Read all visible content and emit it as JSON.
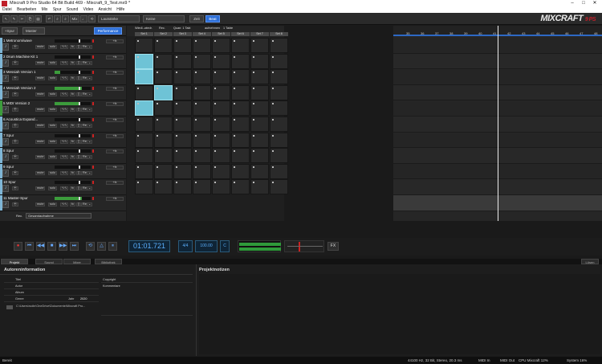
{
  "window": {
    "title": "Mixcraft 9 Pro Studio 64 Bit Build 469 - Mixcraft_9_Test.mx9 *"
  },
  "menu": [
    "Datei",
    "Bearbeiten",
    "Mix",
    "Spur",
    "Sound",
    "Video",
    "Ansicht",
    "Hilfe"
  ],
  "toolbar": {
    "mix_label": "Mix",
    "loudness_select": "Lautstärke",
    "keep_select": "Keine",
    "zeit_label": "Zeit",
    "beat_label": "Beat",
    "brand": "MIXCRAFT",
    "brand_suffix": "9 PS"
  },
  "trackpanel": {
    "add_track": "+Spur",
    "mode_select": "Master",
    "performance_button": "Performance"
  },
  "tracks": [
    {
      "name": "1 Metronom/wave",
      "color": "#7fb6d6",
      "meter": 0
    },
    {
      "name": "2 Drum Machine Kit 1",
      "color": "#7fb6d6",
      "meter": 0
    },
    {
      "name": "3 Messiah Version 1",
      "color": "#7fb6d6",
      "meter": 0.15
    },
    {
      "name": "4 Messiah Version 2",
      "color": "#7fb6d6",
      "meter": 0.75
    },
    {
      "name": "5 MIDI Version 2",
      "color": "#3c9c3c",
      "meter": 0.7
    },
    {
      "name": "6 Acoustica Expand...",
      "color": "#7fb6d6",
      "meter": 0
    },
    {
      "name": "7 Spur",
      "color": "#7fb6d6",
      "meter": 0
    },
    {
      "name": "8 Spur",
      "color": "#7fb6d6",
      "meter": 0
    },
    {
      "name": "9 Spur",
      "color": "#7fb6d6",
      "meter": 0
    },
    {
      "name": "10 Spur",
      "color": "#7fb6d6",
      "meter": 0
    },
    {
      "name": "11 Master-Spur",
      "color": "#7fb6d6",
      "meter": 0.75
    }
  ],
  "track_controls": {
    "mute": "mute",
    "solo": "solo",
    "fx": "fx",
    "rec": "Rec.",
    "fx_short": "+fx"
  },
  "master_extra": {
    "rec_label": "Rec.",
    "rec_select": "Gesamtaufnahme"
  },
  "grid": {
    "header_items": [
      "Wiedl.-wiedr.",
      "Rec.",
      "Quan: 1 Takt",
      "aufnehmen",
      "1 Takte"
    ],
    "sets": [
      "Set 1",
      "Set 2",
      "Set 3",
      "Set 4",
      "Set 5",
      "Set 6",
      "Set 7",
      "Set 8"
    ]
  },
  "ruler": [
    "35",
    "36",
    "37",
    "38",
    "39",
    "40",
    "41",
    "42",
    "43",
    "44",
    "45",
    "46",
    "47",
    "48"
  ],
  "transport": {
    "time": "01:01.721",
    "signature": "4/4",
    "tempo": "100.00",
    "key": "C",
    "fx_label": "FX"
  },
  "bottom_tabs": [
    "Projekt",
    "Sound",
    "Mixer",
    "Bibliothek"
  ],
  "bottom_tab_right": "Lösen",
  "author_info": {
    "heading": "Autoreninformation",
    "fields": [
      "Titel",
      "Autor",
      "Album",
      "Genre"
    ],
    "year_label": "Jahr",
    "year_value": "2020",
    "copyright_label": "Copyright",
    "comments_label": "Kommentare",
    "path": "C:\\Users\\rudin\\OneDrive\\Dokumente\\Mixcraft Pro..."
  },
  "project_notes": {
    "heading": "Projektnotizen"
  },
  "statusbar": {
    "ready": "Bereit",
    "audio": "44100 Hz, 32 Bit, Stereo, 20.3 ms",
    "midi_in": "MIDI In",
    "midi_out": "MIDI Out",
    "cpu": "CPU Mixcraft 12%",
    "system": "System 16%"
  }
}
